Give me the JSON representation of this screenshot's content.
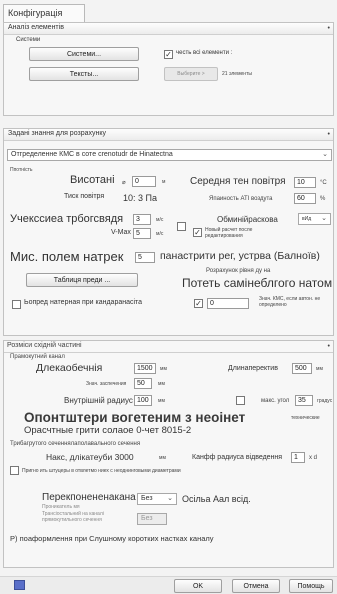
{
  "window": {
    "tab_title": "Конфігурація"
  },
  "analysis": {
    "title": "Аналіз елементів",
    "systems_label": "Системи",
    "btn_systems": "Системи...",
    "btn_text": "Тексты...",
    "chk_all": "честь всі елементи :",
    "btn_select": "Выберите >",
    "elements_count": "21 элементы"
  },
  "params": {
    "title": "Задані знання для розрахунку",
    "method": "Отгределенне КМС в сотe crenotudr de Hinatectna",
    "density_label": "Ппотність",
    "height_label": "Висотані",
    "height_unit_prefix": "⌀",
    "height_value": "0",
    "height_unit": "м",
    "pressure_label": "Тиск повітря",
    "pressure_value": "10: 3 Па",
    "avg_temp_label": "Середня тен повітря",
    "avg_temp_value": "10",
    "avg_temp_unit": "°C",
    "humidity_label": "Япаиность АТІ воздута",
    "humidity_value": "60",
    "humidity_unit": "%",
    "uchkese_label": "Учекссиеа трбогсвядя",
    "uchkese_value": "3",
    "uchkese_unit": "м/с",
    "vmax_label": "V-Max",
    "vmax_value": "5",
    "vmax_unit": "м/с",
    "obmin_label": "Обминійраскова",
    "obmin_value": "вИд",
    "new_calc_label": "Новый расчет после редактирования",
    "field_label": "Мис. полем натрек",
    "field_value": "5",
    "field_after": "панастрити рег, устрва (Балноїв)",
    "calc_level_label": "Розрахунок рівня ду на",
    "table_btn": "Таблиця преди ...",
    "poteт_label": "Потеть самінеблгого натом",
    "loop_label": "Ьопред натерная при кандаранасіта",
    "loop_value": "0",
    "loop_note": "Знач. КМС, если автон. не определено"
  },
  "sizes": {
    "title": "Розміси східній частині",
    "channel_label": "Прамокутний канал",
    "length_label": "Длекаобечнія",
    "length_value": "1500",
    "length_unit": "мм",
    "length2_label": "Длинаперектив",
    "length2_value": "500",
    "length2_unit": "мм",
    "rounding_label": "Знач. заспечения",
    "rounding_value": "50",
    "rounding_unit": "мм",
    "inner_radius_label": "Внутрішній радиус",
    "inner_radius_value": "100",
    "inner_radius_unit": "мм",
    "max_angle_label": "макс. угол",
    "max_angle_value": "35",
    "max_angle_unit": "градус",
    "heading_big": "Опонтштери вогетеним з неоінет",
    "heading_note": "технические",
    "heading_sub": "Орасчтные грити солаое 0-чет 8015-2",
    "trib_title": "Трибагрутого сеченнялаполавального сечення",
    "trib_nom_label": "Накс, длікатеуби 3000",
    "trib_nom_unit": "мм",
    "trib_coef_label": "Канфф радиуса відведення",
    "trib_coef_value": "1",
    "trib_coef_unit": "x d",
    "trib_chk_label": "Пригно ить штуцеры в отвлетмо ниех с неоднинговыми диаметрами",
    "recon_label": "Перекпонененакана",
    "recon_sub": "Проникатель мя",
    "recon_sel": "Без",
    "recon_after": "Осільа Аал всід.",
    "recon2_label": "Трансіостальний на каналі прямокутильного сечення",
    "recon2_sel": "Без",
    "notify_label": "Р) поаформлення при Слушному коротких настках каналу"
  },
  "footer": {
    "ok": "OK",
    "cancel": "Отмена",
    "help": "Помощь"
  }
}
